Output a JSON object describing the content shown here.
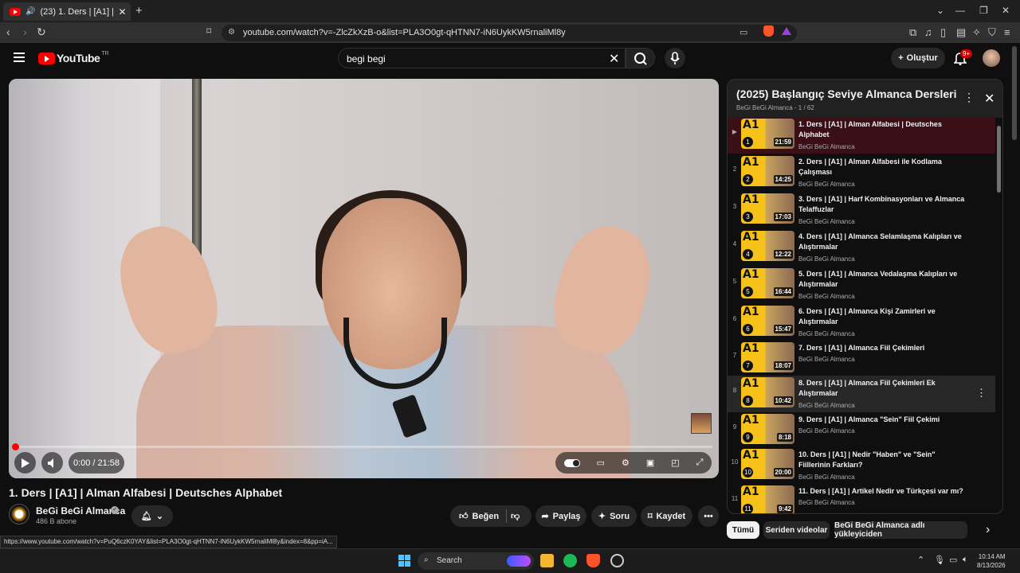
{
  "browser": {
    "tab_title": "(23) 1. Ders | [A1] | Alman Alfa",
    "url": "youtube.com/watch?v=-ZlcZkXzB-o&list=PLA3O0gt-qHTNN7-iN6UykKW5rnaliMl8y",
    "status_url": "https://www.youtube.com/watch?v=PuQ6czK0YAY&list=PLA3O0gt-qHTNN7-iN6UykKW5rnaliMl8y&index=8&pp=iA..."
  },
  "header": {
    "logo": "YouTube",
    "region": "TR",
    "search_value": "begi begi",
    "create_label": "Oluştur",
    "notif_count": "9+"
  },
  "player": {
    "time": "0:00 / 21:58",
    "progress": 0.0
  },
  "video": {
    "title": "1. Ders | [A1] | Alman Alfabesi | Deutsches Alphabet",
    "channel": "BeGi BeGi Almanca",
    "subscribers": "486 B abone",
    "actions": {
      "like": "Beğen",
      "share": "Paylaş",
      "ask": "Soru",
      "save": "Kaydet"
    }
  },
  "playlist": {
    "title": "(2025) Başlangıç Seviye Almanca Dersleri",
    "subtitle": "BeGi BeGi Almanca - 1 / 62",
    "items": [
      {
        "index": "▶",
        "num": "1",
        "title": "1. Ders | [A1] | Alman Alfabesi | Deutsches Alphabet",
        "channel": "BeGi BeGi Almanca",
        "duration": "21:59"
      },
      {
        "index": "2",
        "num": "2",
        "title": "2. Ders | [A1] | Alman Alfabesi ile Kodlama Çalışması",
        "channel": "BeGi BeGi Almanca",
        "duration": "14:25"
      },
      {
        "index": "3",
        "num": "3",
        "title": "3. Ders | [A1] | Harf Kombinasyonları ve Almanca Telaffuzlar",
        "channel": "BeGi BeGi Almanca",
        "duration": "17:03"
      },
      {
        "index": "4",
        "num": "4",
        "title": "4. Ders | [A1] | Almanca Selamlaşma Kalıpları ve Alıştırmalar",
        "channel": "BeGi BeGi Almanca",
        "duration": "12:22"
      },
      {
        "index": "5",
        "num": "5",
        "title": "5. Ders | [A1] | Almanca Vedalaşma Kalıpları ve Alıştırmalar",
        "channel": "BeGi BeGi Almanca",
        "duration": "16:44"
      },
      {
        "index": "6",
        "num": "6",
        "title": "6. Ders | [A1] | Almanca Kişi Zamirleri ve Alıştırmalar",
        "channel": "BeGi BeGi Almanca",
        "duration": "15:47"
      },
      {
        "index": "7",
        "num": "7",
        "title": "7. Ders | [A1] | Almanca Fiil Çekimleri",
        "channel": "BeGi BeGi Almanca",
        "duration": "18:07"
      },
      {
        "index": "8",
        "num": "8",
        "title": "8. Ders | [A1] | Almanca Fiil Çekimleri Ek Alıştırmalar",
        "channel": "BeGi BeGi Almanca",
        "duration": "10:42"
      },
      {
        "index": "9",
        "num": "9",
        "title": "9. Ders | [A1] | Almanca \"Sein\" Fiil Çekimi",
        "channel": "BeGi BeGi Almanca",
        "duration": "8:18"
      },
      {
        "index": "10",
        "num": "10",
        "title": "10. Ders | [A1] | Nedir \"Haben\" ve \"Sein\" Fiillerinin Farkları?",
        "channel": "BeGi BeGi Almanca",
        "duration": "20:00"
      },
      {
        "index": "11",
        "num": "11",
        "title": "11. Ders | [A1] | Artikel Nedir ve Türkçesi var mı?",
        "channel": "BeGi BeGi Almanca",
        "duration": "9:42"
      }
    ]
  },
  "chips": [
    "Tümü",
    "Seriden videolar",
    "BeGi BeGi Almanca adlı yükleyiciden"
  ],
  "taskbar": {
    "search": "Search",
    "time": "10:14 AM",
    "date": "8/13/2026"
  },
  "colors": {
    "accent": "#ff0000",
    "active_row": "#3a0f16"
  }
}
